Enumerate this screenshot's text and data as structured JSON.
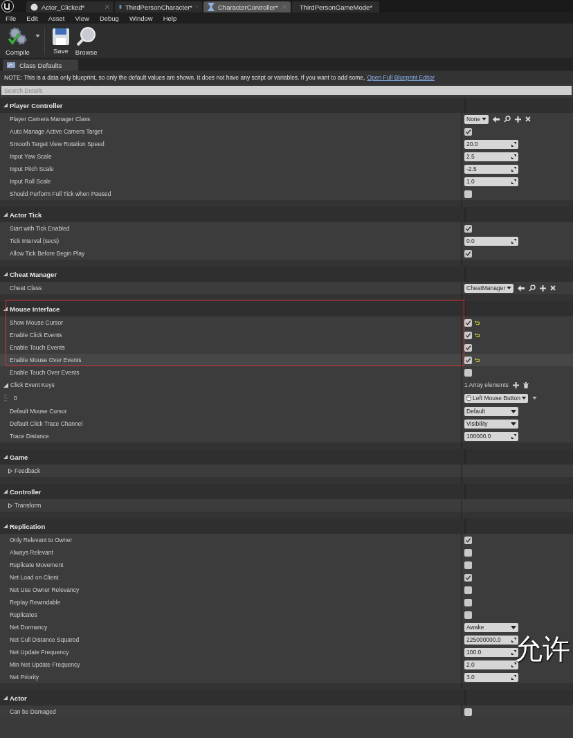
{
  "tabs": [
    {
      "label": "Actor_Clicked*",
      "kind": "sphere",
      "selected": false
    },
    {
      "label": "ThirdPersonCharacter*",
      "kind": "figure",
      "selected": false
    },
    {
      "label": "CharacterController*",
      "kind": "controller",
      "selected": true
    },
    {
      "label": "ThirdPersonGameMode*",
      "kind": "monitor",
      "selected": false
    }
  ],
  "menu": [
    "File",
    "Edit",
    "Asset",
    "View",
    "Debug",
    "Window",
    "Help"
  ],
  "toolbar": [
    {
      "label": "Compile",
      "kind": "compile"
    },
    {
      "label": "Save",
      "kind": "save"
    },
    {
      "label": "Browse",
      "kind": "browse"
    }
  ],
  "panel_tab": {
    "label": "Class Defaults"
  },
  "note": {
    "text": "NOTE: This is a data only blueprint, so only the default values are shown.  It does not have any script or variables.  If you want to add some,",
    "link": "Open Full Blueprint Editor"
  },
  "search": {
    "placeholder": "Search Details"
  },
  "sections": [
    {
      "title": "Player Controller",
      "rows": [
        {
          "label": "Player Camera Manager Class",
          "kind": "class",
          "value": "None"
        },
        {
          "label": "Auto Manage Active Camera Target",
          "kind": "checkbox",
          "checked": true
        },
        {
          "label": "Smooth Target View Rotation Speed",
          "kind": "number",
          "value": "20.0"
        },
        {
          "label": "Input Yaw Scale",
          "kind": "number",
          "value": "2.5"
        },
        {
          "label": "Input Pitch Scale",
          "kind": "number",
          "value": "-2.5"
        },
        {
          "label": "Input Roll Scale",
          "kind": "number",
          "value": "1.0"
        },
        {
          "label": "Should Perform Full Tick when Paused",
          "kind": "checkbox",
          "checked": false
        }
      ]
    },
    {
      "title": "Actor Tick",
      "rows": [
        {
          "label": "Start with Tick Enabled",
          "kind": "checkbox",
          "checked": true
        },
        {
          "label": "Tick Interval (secs)",
          "kind": "number",
          "value": "0.0"
        },
        {
          "label": "Allow Tick Before Begin Play",
          "kind": "checkbox",
          "checked": true
        }
      ]
    },
    {
      "title": "Cheat Manager",
      "rows": [
        {
          "label": "Cheat Class",
          "kind": "class",
          "value": "CheatManager"
        }
      ]
    },
    {
      "title": "Mouse Interface",
      "highlighted": true,
      "rows": [
        {
          "label": "Show Mouse Cursor",
          "kind": "checkbox",
          "checked": true,
          "reset": true,
          "highlighted": true
        },
        {
          "label": "Enable Click Events",
          "kind": "checkbox",
          "checked": true,
          "reset": true,
          "highlighted": true
        },
        {
          "label": "Enable Touch Events",
          "kind": "checkbox",
          "checked": true,
          "highlighted": true
        },
        {
          "label": "Enable Mouse Over Events",
          "kind": "checkbox",
          "checked": true,
          "reset": true,
          "highlighted": true,
          "hovered": true
        },
        {
          "label": "Enable Touch Over Events",
          "kind": "checkbox",
          "checked": false
        },
        {
          "label": "Click Event Keys",
          "kind": "array",
          "value": "1 Array elements",
          "expanded": true
        },
        {
          "label": "0",
          "kind": "array_item",
          "value": "Left Mouse Button"
        },
        {
          "label": "Default Mouse Cursor",
          "kind": "combo",
          "value": "Default"
        },
        {
          "label": "Default Click Trace Channel",
          "kind": "combo",
          "value": "Visibility"
        },
        {
          "label": "Trace Distance",
          "kind": "number",
          "value": "100000.0"
        }
      ]
    },
    {
      "title": "Game",
      "rows": [
        {
          "label": "Feedback",
          "kind": "group",
          "expanded": false
        }
      ]
    },
    {
      "title": "Controller",
      "rows": [
        {
          "label": "Transform",
          "kind": "group",
          "expanded": false
        }
      ]
    },
    {
      "title": "Replication",
      "rows": [
        {
          "label": "Only Relevant to Owner",
          "kind": "checkbox",
          "checked": true
        },
        {
          "label": "Always Relevant",
          "kind": "checkbox",
          "checked": false
        },
        {
          "label": "Replicate Movement",
          "kind": "checkbox",
          "checked": false
        },
        {
          "label": "Net Load on Client",
          "kind": "checkbox",
          "checked": true
        },
        {
          "label": "Net Use Owner Relevancy",
          "kind": "checkbox",
          "checked": false
        },
        {
          "label": "Replay Rewindable",
          "kind": "checkbox",
          "checked": false
        },
        {
          "label": "Replicates",
          "kind": "checkbox",
          "checked": false
        },
        {
          "label": "Net Dormancy",
          "kind": "combo",
          "value": "Awake"
        },
        {
          "label": "Net Cull Distance Squared",
          "kind": "number",
          "value": "225000000.0"
        },
        {
          "label": "Net Update Frequency",
          "kind": "number",
          "value": "100.0"
        },
        {
          "label": "Min Net Update Frequency",
          "kind": "number",
          "value": "2.0"
        },
        {
          "label": "Net Priority",
          "kind": "number",
          "value": "3.0"
        }
      ]
    },
    {
      "title": "Actor",
      "rows": [
        {
          "label": "Can be Damaged",
          "kind": "checkbox",
          "checked": false
        }
      ]
    }
  ],
  "caption": "允许"
}
